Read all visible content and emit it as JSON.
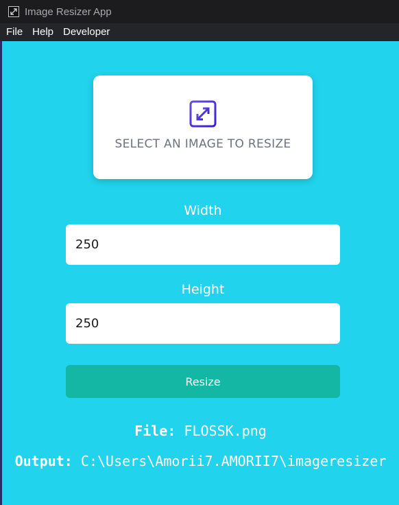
{
  "window": {
    "title": "Image Resizer App"
  },
  "menu": {
    "items": [
      "File",
      "Help",
      "Developer"
    ]
  },
  "select_card": {
    "label": "SELECT AN IMAGE TO RESIZE",
    "icon": "expand-arrows-icon",
    "icon_color": "#5b2fd6"
  },
  "width": {
    "label": "Width",
    "value": "250"
  },
  "height": {
    "label": "Height",
    "value": "250"
  },
  "resize_button": {
    "label": "Resize",
    "color": "#14b7a4"
  },
  "file_info": {
    "label": "File:",
    "value": "FLOSSK.png"
  },
  "output_info": {
    "label": "Output:",
    "value": "C:\\Users\\Amorii7.AMORII7\\imageresizer"
  },
  "colors": {
    "background": "#21d3ec",
    "titlebar": "#1c1c1e",
    "menubar": "#242528"
  }
}
